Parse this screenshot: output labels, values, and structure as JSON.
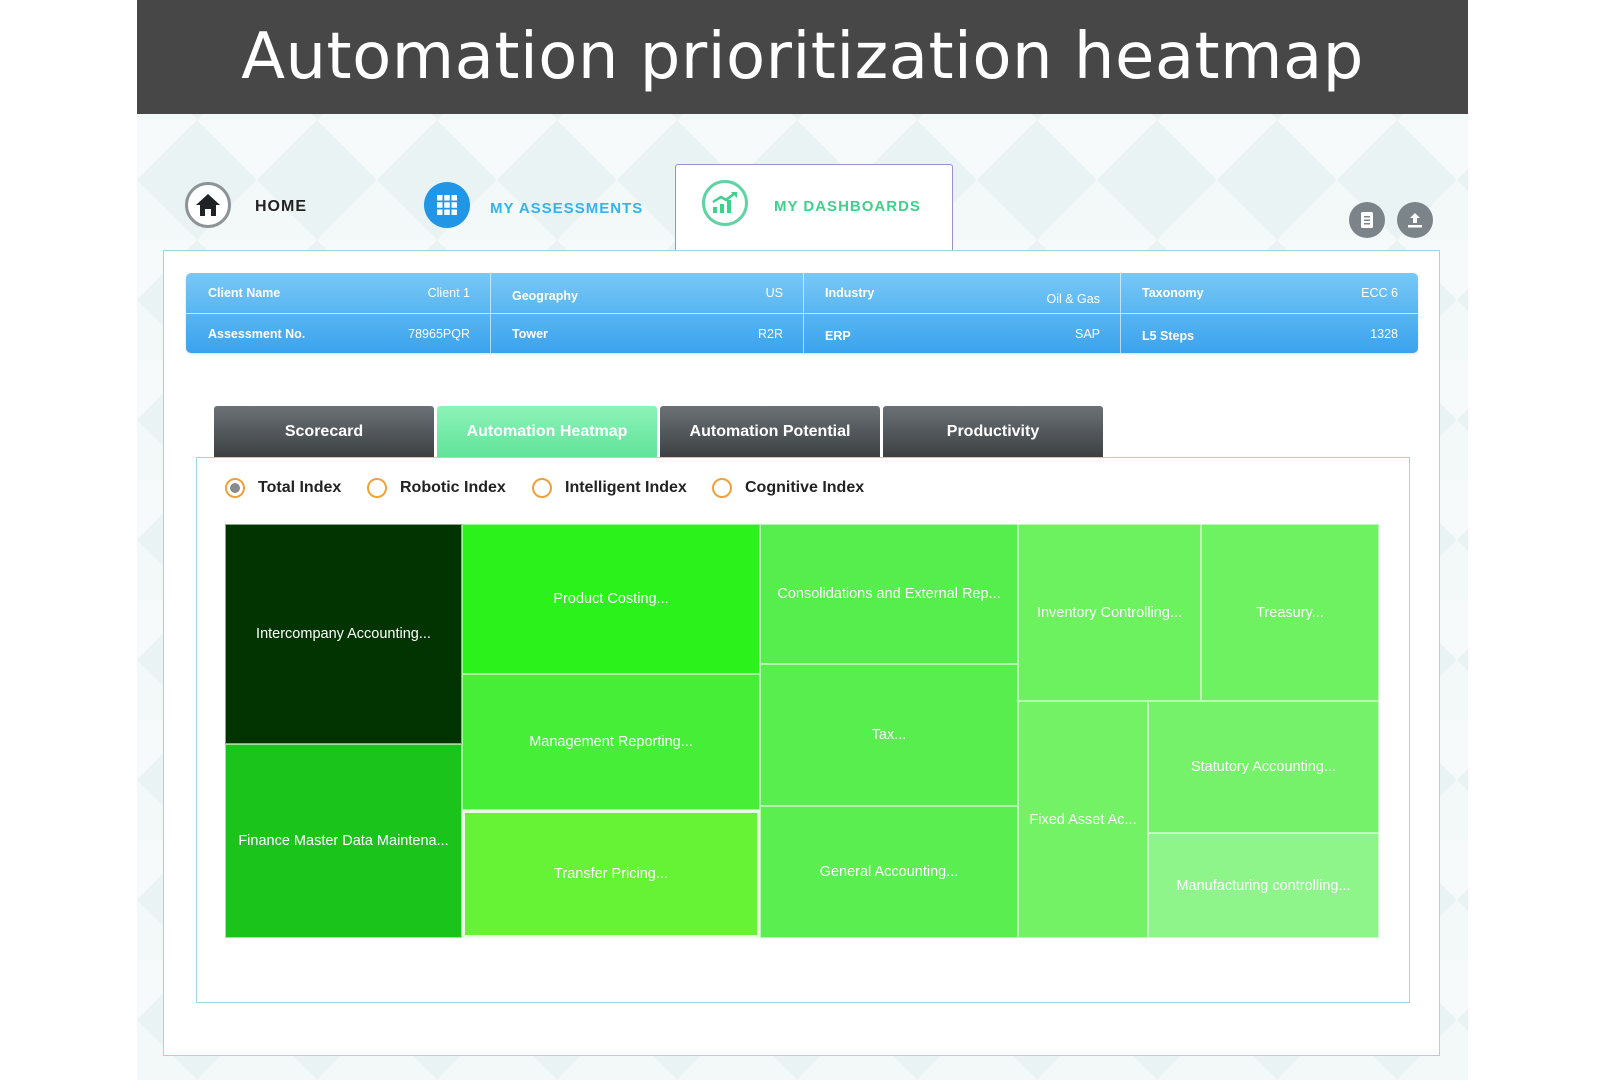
{
  "title": "Automation prioritization heatmap",
  "nav": {
    "home": "HOME",
    "assessments": "MY ASSESSMENTS",
    "dashboards": "MY DASHBOARDS"
  },
  "icons": [
    "home-icon",
    "grid-icon",
    "chart-icon",
    "document-icon",
    "upload-icon"
  ],
  "info": {
    "client_name_label": "Client Name",
    "client_name": "Client 1",
    "assessment_label": "Assessment No.",
    "assessment": "78965PQR",
    "geography_label": "Geography",
    "geography": "US",
    "tower_label": "Tower",
    "tower": "R2R",
    "industry_label": "Industry",
    "industry": "Oil & Gas",
    "erp_label": "ERP",
    "erp": "SAP",
    "taxonomy_label": "Taxonomy",
    "taxonomy": "ECC 6",
    "l5_label": "L5 Steps",
    "l5": "1328"
  },
  "tabs": [
    "Scorecard",
    "Automation Heatmap",
    "Automation Potential",
    "Productivity"
  ],
  "active_tab": "Automation Heatmap",
  "radios": [
    "Total Index",
    "Robotic Index",
    "Intelligent Index",
    "Cognitive Index"
  ],
  "selected_radio": "Total Index",
  "colors": {
    "accent_blue": "#3aa3ee",
    "active_tab": "#5fe39a",
    "radio_ring": "#f0a13a"
  },
  "treemap": [
    {
      "label": "Intercompany Accounting...",
      "color": "#023402"
    },
    {
      "label": "Finance Master Data Maintena...",
      "color": "#1bc41b"
    },
    {
      "label": "Product Costing...",
      "color": "#2bf21b"
    },
    {
      "label": "Management Reporting...",
      "color": "#46ee38"
    },
    {
      "label": "Transfer Pricing...",
      "color": "#66f235"
    },
    {
      "label": "Consolidations and External Rep...",
      "color": "#55ee4c"
    },
    {
      "label": "Tax...",
      "color": "#58ee4e"
    },
    {
      "label": "General Accounting...",
      "color": "#5aee50"
    },
    {
      "label": "Inventory Controlling...",
      "color": "#6bf25e"
    },
    {
      "label": "Treasury...",
      "color": "#6ef262"
    },
    {
      "label": "Fixed Asset Ac...",
      "color": "#72f264"
    },
    {
      "label": "Statutory Accounting...",
      "color": "#75f26a"
    },
    {
      "label": "Manufacturing controlling...",
      "color": "#8ef58a"
    }
  ]
}
